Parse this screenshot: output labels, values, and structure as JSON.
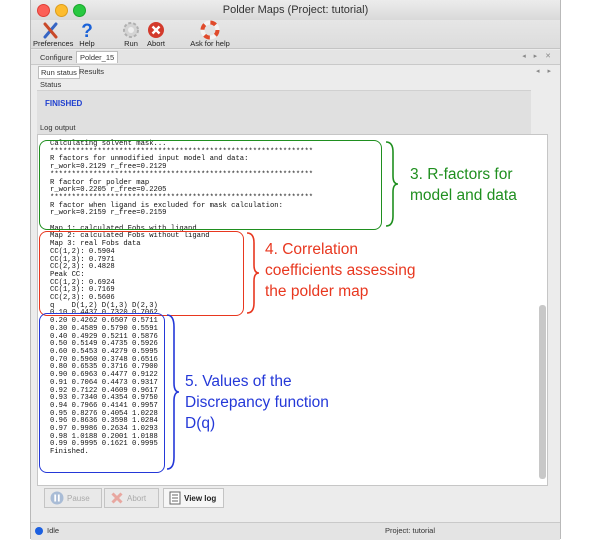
{
  "window": {
    "title": "Polder Maps (Project: tutorial)"
  },
  "toolbar": {
    "preferences": "Preferences",
    "help": "Help",
    "run": "Run",
    "abort": "Abort",
    "ask_for_help": "Ask for help"
  },
  "tabs": {
    "configure": "Configure",
    "polder": "Polder_15"
  },
  "subtabs": {
    "run_status": "Run status",
    "results": "Results"
  },
  "status": {
    "label": "Status",
    "value": "FINISHED"
  },
  "log": {
    "label": "Log output",
    "lines": [
      "Calculating solvent mask...",
      "*************************************************************",
      "R factors for unmodified input model and data:",
      "r_work=0.2129 r_free=0.2129",
      "*************************************************************",
      "R factor for polder map",
      "r_work=0.2205 r_free=0.2205",
      "*************************************************************",
      "R factor when ligand is excluded for mask calculation:",
      "r_work=0.2159 r_free=0.2159",
      "",
      "Map 1: calculated Fobs with ligand",
      "Map 2: calculated Fobs without ligand",
      "Map 3: real Fobs data",
      "CC(1,2): 0.5904",
      "CC(1,3): 0.7971",
      "CC(2,3): 0.4828",
      "Peak CC:",
      "CC(1,2): 0.6924",
      "CC(1,3): 0.7169",
      "CC(2,3): 0.5606",
      "q    D(1,2) D(1,3) D(2,3)",
      "0.10 0.4437 0.7320 0.7062",
      "0.20 0.4262 0.6507 0.5711",
      "0.30 0.4589 0.5790 0.5591",
      "0.40 0.4929 0.5211 0.5876",
      "0.50 0.5149 0.4735 0.5926",
      "0.60 0.5453 0.4279 0.5995",
      "0.70 0.5960 0.3748 0.6516",
      "0.80 0.6535 0.3716 0.7900",
      "0.90 0.6963 0.4477 0.9122",
      "0.91 0.7064 0.4473 0.9317",
      "0.92 0.7122 0.4609 0.9617",
      "0.93 0.7340 0.4354 0.9750",
      "0.94 0.7966 0.4141 0.9957",
      "0.95 0.8276 0.4054 1.0228",
      "0.96 0.8636 0.3598 1.0284",
      "0.97 0.9986 0.2634 1.0293",
      "0.98 1.0188 0.2001 1.0188",
      "0.99 0.9995 0.1621 0.9995",
      "Finished."
    ]
  },
  "buttons": {
    "pause": "Pause",
    "abort": "Abort",
    "view_log": "View log"
  },
  "statusbar": {
    "state": "Idle",
    "project": "Project: tutorial"
  },
  "annotations": {
    "rfactors_line1": "3. R-factors for",
    "rfactors_line2": "model and data",
    "cc_line1": "4. Correlation",
    "cc_line2": "coefficients assessing",
    "cc_line3": "the polder map",
    "disc_line1": "5. Values of the",
    "disc_line2": "Discrepancy function",
    "disc_line3": "D(q)"
  },
  "colors": {
    "green": "#1f8f1f",
    "red": "#e8371f",
    "blue": "#2438d8",
    "finished": "#1f3fd0"
  },
  "icons": [
    "preferences-icon",
    "help-icon",
    "run-icon",
    "abort-icon",
    "lifebuoy-icon",
    "pause-icon",
    "abort-small-icon",
    "log-icon",
    "status-dot-icon"
  ]
}
